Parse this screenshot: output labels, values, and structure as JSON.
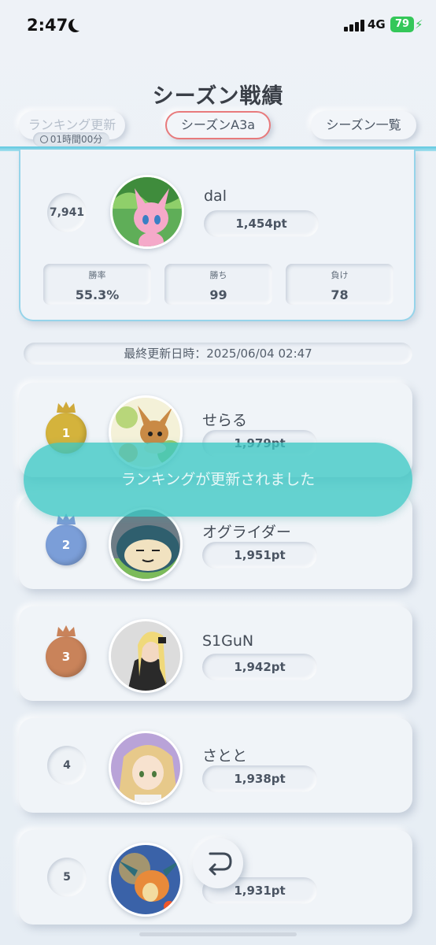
{
  "status_bar": {
    "time": "2:47",
    "network": "4G",
    "battery": "79"
  },
  "header": {
    "title": "シーズン戦績",
    "ranking_update_label": "ランキング更新",
    "timer": "01時間00分",
    "season_label": "シーズンA3a",
    "season_list_label": "シーズン一覧"
  },
  "my_stats": {
    "rank": "7,941",
    "name": "dal",
    "points": "1,454pt",
    "win_rate_label": "勝率",
    "win_rate": "55.3%",
    "wins_label": "勝ち",
    "wins": "99",
    "losses_label": "負け",
    "losses": "78"
  },
  "last_updated": "最終更新日時：2025/06/04 02:47",
  "toast": "ランキングが更新されました",
  "rankings": [
    {
      "rank": "1",
      "name": "せらる",
      "points": "1,979pt",
      "medal_color": "#d4b33c"
    },
    {
      "rank": "2",
      "name": "オグライダー",
      "points": "1,951pt",
      "medal_color": "#7b9ed8"
    },
    {
      "rank": "3",
      "name": "S1GuN",
      "points": "1,942pt",
      "medal_color": "#c9835a"
    },
    {
      "rank": "4",
      "name": "さとと",
      "points": "1,938pt"
    },
    {
      "rank": "5",
      "name": "",
      "points": "1,931pt"
    }
  ],
  "icons": {
    "back": "return-arrow-icon",
    "timer": "clock-icon"
  }
}
